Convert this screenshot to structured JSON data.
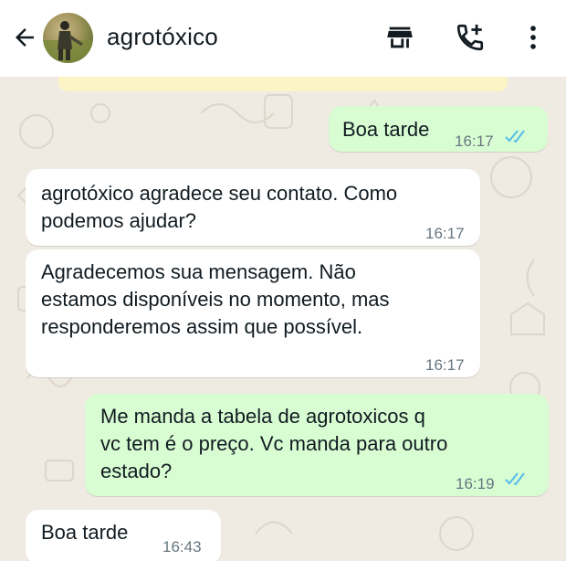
{
  "header": {
    "contact_name": "agrotóxico",
    "icons": [
      "back-arrow-icon",
      "storefront-icon",
      "add-call-icon",
      "more-vert-icon"
    ]
  },
  "messages": [
    {
      "direction": "out",
      "text": "Boa tarde",
      "time": "16:17",
      "status": "read"
    },
    {
      "direction": "in",
      "text": "agrotóxico agradece seu contato. Como\npodemos ajudar?",
      "time": "16:17"
    },
    {
      "direction": "in",
      "text": "Agradecemos sua mensagem. Não\nestamos disponíveis no momento, mas\nresponderemos assim que possível.",
      "time": "16:17"
    },
    {
      "direction": "out",
      "text": "Me manda a tabela de agrotoxicos q\nvc tem é o preço. Vc manda para outro\nestado?",
      "time": "16:19",
      "status": "read"
    },
    {
      "direction": "in",
      "text": "Boa tarde",
      "time": "16:43"
    }
  ],
  "colors": {
    "chat_background": "#efeae2",
    "incoming_bubble": "#ffffff",
    "outgoing_bubble": "#d9fdd3",
    "read_ticks": "#53bdeb",
    "timestamp": "#667781"
  }
}
